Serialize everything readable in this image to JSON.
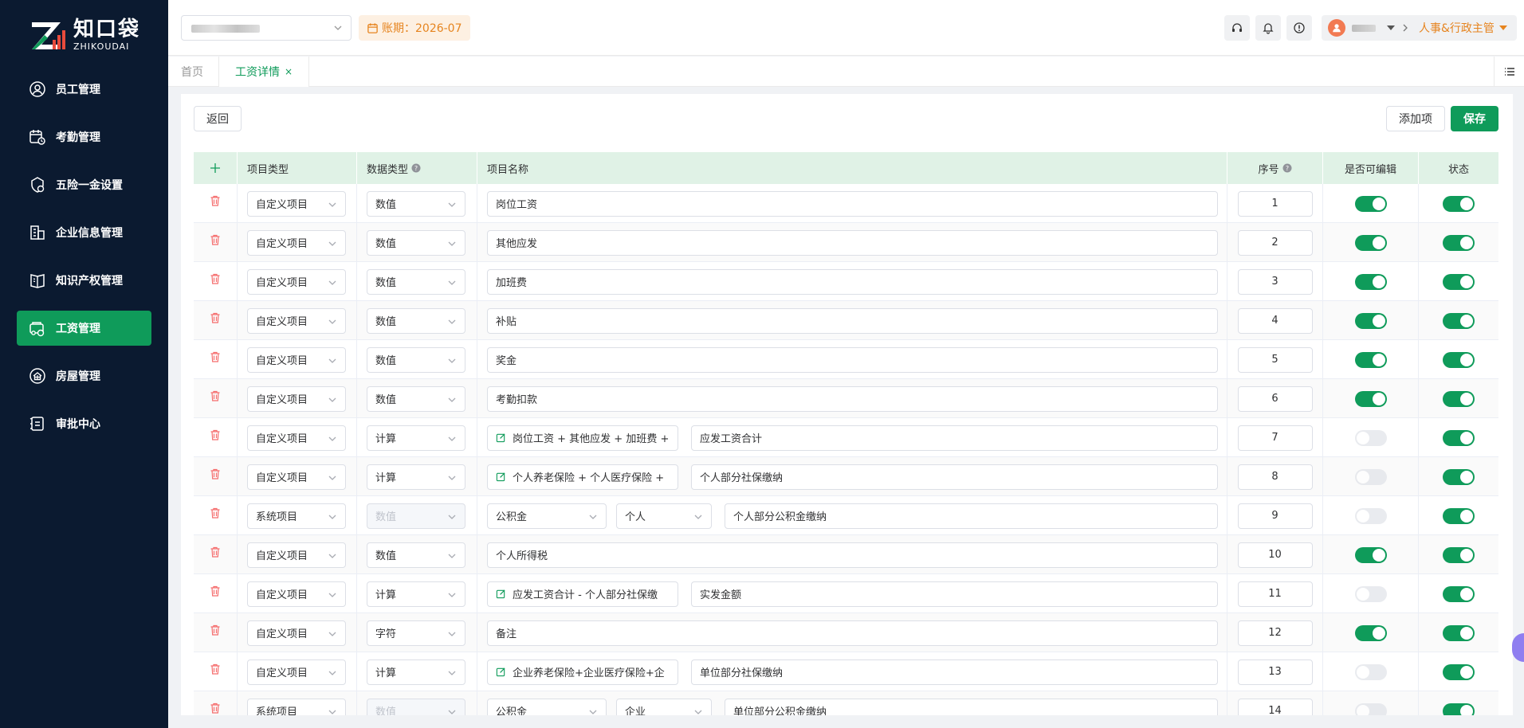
{
  "brand": {
    "name_cn": "知口袋",
    "name_en": "ZHIKOUDAI"
  },
  "sidebar": {
    "items": [
      {
        "label": "员工管理",
        "icon": "user-circle-icon",
        "active": false
      },
      {
        "label": "考勤管理",
        "icon": "calendar-clock-icon",
        "active": false
      },
      {
        "label": "五险一金设置",
        "icon": "shield-settings-icon",
        "active": false
      },
      {
        "label": "企业信息管理",
        "icon": "building-icon",
        "active": false
      },
      {
        "label": "知识产权管理",
        "icon": "book-icon",
        "active": false
      },
      {
        "label": "工资管理",
        "icon": "wallet-icon",
        "active": true
      },
      {
        "label": "房屋管理",
        "icon": "house-icon",
        "active": false
      },
      {
        "label": "审批中心",
        "icon": "approval-icon",
        "active": false
      }
    ]
  },
  "header": {
    "period_label": "账期：2026-07",
    "role": "人事&行政主管"
  },
  "tabs": {
    "home": "首页",
    "active": "工资详情",
    "close": "×"
  },
  "toolbar": {
    "back": "返回",
    "add_item": "添加项",
    "save": "保存"
  },
  "table": {
    "headers": {
      "type": "项目类型",
      "data_type": "数据类型",
      "name": "项目名称",
      "seq": "序号",
      "editable": "是否可编辑",
      "status": "状态"
    },
    "rows": [
      {
        "type": "自定义项目",
        "data_type": "数值",
        "kind": "plain",
        "name": "岗位工资",
        "seq": "1",
        "editable": true,
        "status": true
      },
      {
        "type": "自定义项目",
        "data_type": "数值",
        "kind": "plain",
        "name": "其他应发",
        "seq": "2",
        "editable": true,
        "status": true
      },
      {
        "type": "自定义项目",
        "data_type": "数值",
        "kind": "plain",
        "name": "加班费",
        "seq": "3",
        "editable": true,
        "status": true
      },
      {
        "type": "自定义项目",
        "data_type": "数值",
        "kind": "plain",
        "name": "补贴",
        "seq": "4",
        "editable": true,
        "status": true
      },
      {
        "type": "自定义项目",
        "data_type": "数值",
        "kind": "plain",
        "name": "奖金",
        "seq": "5",
        "editable": true,
        "status": true
      },
      {
        "type": "自定义项目",
        "data_type": "数值",
        "kind": "plain",
        "name": "考勤扣款",
        "seq": "6",
        "editable": true,
        "status": true
      },
      {
        "type": "自定义项目",
        "data_type": "计算",
        "kind": "formula",
        "formula": "岗位工资 + 其他应发 + 加班费 +",
        "name": "应发工资合计",
        "seq": "7",
        "editable": false,
        "status": true
      },
      {
        "type": "自定义项目",
        "data_type": "计算",
        "kind": "formula",
        "formula": "个人养老保险 + 个人医疗保险 +",
        "name": "个人部分社保缴纳",
        "seq": "8",
        "editable": false,
        "status": true
      },
      {
        "type": "系统项目",
        "data_type": "数值",
        "kind": "system",
        "fund": "公积金",
        "party": "个人",
        "name": "个人部分公积金缴纳",
        "seq": "9",
        "editable": false,
        "status": true
      },
      {
        "type": "自定义项目",
        "data_type": "数值",
        "kind": "plain",
        "name": "个人所得税",
        "seq": "10",
        "editable": true,
        "status": true
      },
      {
        "type": "自定义项目",
        "data_type": "计算",
        "kind": "formula",
        "formula": "应发工资合计 - 个人部分社保缴",
        "name": "实发金额",
        "seq": "11",
        "editable": false,
        "status": true
      },
      {
        "type": "自定义项目",
        "data_type": "字符",
        "kind": "plain",
        "name": "备注",
        "seq": "12",
        "editable": true,
        "status": true
      },
      {
        "type": "自定义项目",
        "data_type": "计算",
        "kind": "formula",
        "formula": "企业养老保险+企业医疗保险+企",
        "name": "单位部分社保缴纳",
        "seq": "13",
        "editable": false,
        "status": true
      },
      {
        "type": "系统项目",
        "data_type": "数值",
        "kind": "system",
        "fund": "公积金",
        "party": "企业",
        "name": "单位部分公积金缴纳",
        "seq": "14",
        "editable": false,
        "status": true
      }
    ]
  },
  "colors": {
    "primary": "#0f9b5a",
    "sidebar_bg": "#0b1a30",
    "accent_orange": "#e6841f",
    "delete_red": "#f56c6c"
  }
}
